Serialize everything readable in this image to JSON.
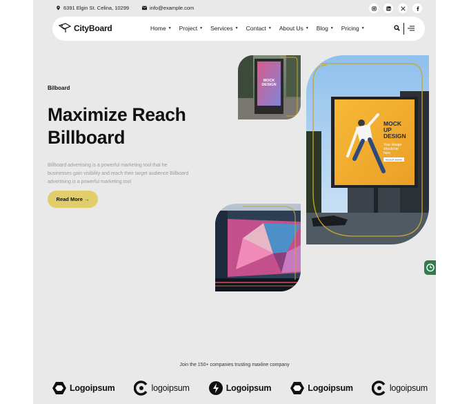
{
  "topbar": {
    "address": "6391 Elgin St. Celina, 10299",
    "email": "info@example.com",
    "socials": [
      {
        "name": "instagram",
        "icon": "instagram-icon"
      },
      {
        "name": "linkedin",
        "icon": "linkedin-icon"
      },
      {
        "name": "x",
        "icon": "x-icon"
      },
      {
        "name": "facebook",
        "icon": "facebook-icon"
      }
    ]
  },
  "header": {
    "logo": "CityBoard",
    "nav": [
      "Home",
      "Project",
      "Services",
      "Contact",
      "About Us",
      "Blog",
      "Pricing"
    ]
  },
  "hero": {
    "eyebrow": "Bilboard",
    "title_line1": "Maximize Reach",
    "title_line2": "Billboard",
    "description": "Billboard advertising is a powerful marketing tool that he businesses gain visibility and reach their target audience Billboard advertising is a powerful marketing tool",
    "button": "Read More →"
  },
  "billboard": {
    "main_headline": [
      "MOCK",
      "UP",
      "DESIGN"
    ],
    "main_sub": [
      "Your design",
      "should be",
      "here"
    ],
    "main_cta": "MOCKUP SHOWN",
    "street_text": [
      "MOCK",
      "DESIGN"
    ]
  },
  "colors": {
    "accent": "#e2cd6c",
    "page": "#e9e9e9",
    "billboard_yellow": "#f2b230",
    "frame_gold": "#c9a531"
  },
  "trust": {
    "text": "Join the 150+ companies trusting maxline company",
    "logos": [
      "Logoipsum",
      "logoipsum",
      "Logoipsum",
      "Logoipsum",
      "logoipsum"
    ]
  }
}
